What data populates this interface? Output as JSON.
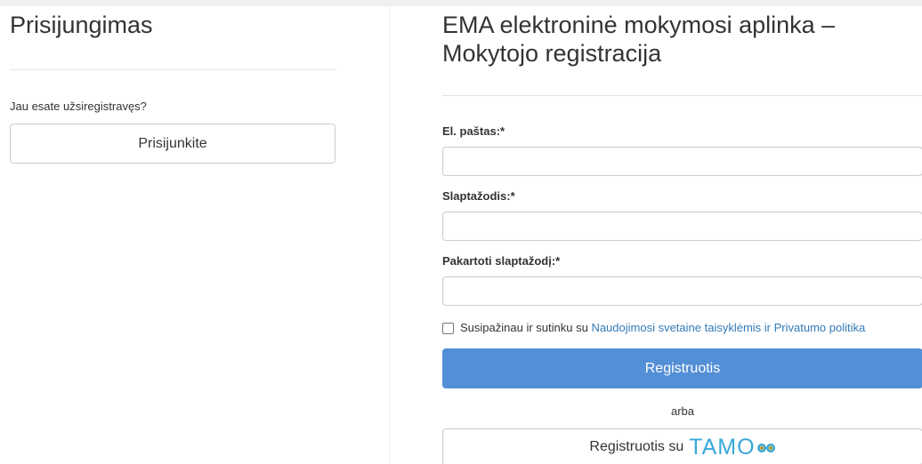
{
  "login": {
    "title": "Prisijungimas",
    "question": "Jau esate užsiregistravęs?",
    "button_label": "Prisijunkite"
  },
  "register": {
    "title": "EMA elektroninė mokymosi aplinka – Mokytojo registracija",
    "email_label": "El. paštas:*",
    "email_value": "",
    "password_label": "Slaptažodis:*",
    "password_value": "",
    "repeat_password_label": "Pakartoti slaptažodį:*",
    "repeat_password_value": "",
    "terms_text": "Susipažinau ir sutinku su ",
    "terms_link": "Naudojimosi svetaine taisyklėmis ir Privatumo politika",
    "terms_checked": false,
    "submit_label": "Registruotis",
    "or_text": "arba",
    "tamo_label": "Registruotis su",
    "tamo_logo": "TAMO",
    "tamo_icon": "owl-eyes-icon"
  },
  "colors": {
    "primary_button": "#538fd6",
    "link": "#337ab7",
    "tamo_brand": "#38a8d8"
  }
}
